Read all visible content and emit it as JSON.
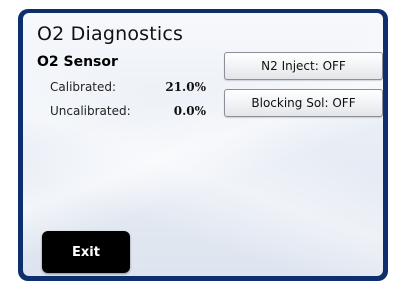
{
  "screen": {
    "title": "O2 Diagnostics"
  },
  "sensor": {
    "heading": "O2 Sensor",
    "rows": [
      {
        "label": "Calibrated:",
        "value": "21.0%"
      },
      {
        "label": "Uncalibrated:",
        "value": "0.0%"
      }
    ]
  },
  "buttons": {
    "n2_inject": "N2 Inject: OFF",
    "blocking_sol": "Blocking Sol: OFF",
    "exit": "Exit"
  },
  "colors": {
    "frame": "#0d2f6d",
    "exit_bg": "#000000"
  }
}
